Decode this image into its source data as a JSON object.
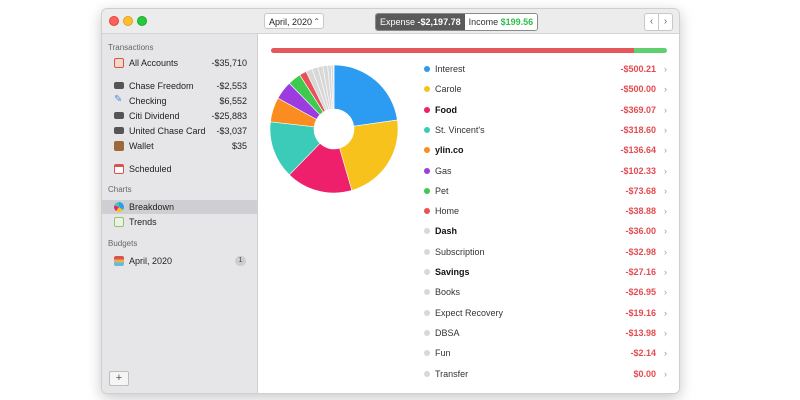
{
  "toolbar": {
    "month": "April, 2020",
    "expense_label": "Expense",
    "expense_amount": "-$2,197.78",
    "income_label": "Income",
    "income_amount": "$199.56",
    "prev_icon": "chevron-left-icon",
    "next_icon": "chevron-right-icon"
  },
  "sidebar": {
    "transactions_title": "Transactions",
    "accounts": [
      {
        "label": "All Accounts",
        "value": "-$35,710",
        "icon": "inbox-icon",
        "color": "#d9534f"
      },
      {
        "label": "Chase Freedom",
        "value": "-$2,553",
        "icon": "credit-card-icon",
        "color": "#555555"
      },
      {
        "label": "Checking",
        "value": "$6,552",
        "icon": "pencil-icon",
        "color": "#4a90d9"
      },
      {
        "label": "Citi Dividend",
        "value": "-$25,883",
        "icon": "credit-card-icon",
        "color": "#555555"
      },
      {
        "label": "United Chase Card",
        "value": "-$3,037",
        "icon": "credit-card-icon",
        "color": "#555555"
      },
      {
        "label": "Wallet",
        "value": "$35",
        "icon": "wallet-icon",
        "color": "#8b5a2b"
      }
    ],
    "scheduled": {
      "label": "Scheduled",
      "icon": "calendar-icon"
    },
    "charts_title": "Charts",
    "charts": [
      {
        "label": "Breakdown",
        "icon": "pie-chart-icon",
        "selected": true
      },
      {
        "label": "Trends",
        "icon": "line-chart-icon",
        "selected": false
      }
    ],
    "budgets_title": "Budgets",
    "budgets": [
      {
        "label": "April, 2020",
        "badge": "1",
        "icon": "budget-icon"
      }
    ],
    "add_label": "+"
  },
  "summary_bar": {
    "expense_fraction": 0.917,
    "income_fraction": 0.083,
    "expense_color": "#e5575a",
    "income_color": "#5fcf6f"
  },
  "chart_data": {
    "type": "pie",
    "donut": true,
    "series": [
      {
        "name": "Interest",
        "value": 500.21,
        "color": "#2b9cf2",
        "bold": false
      },
      {
        "name": "Carole",
        "value": 500.0,
        "color": "#f6c21b",
        "bold": false
      },
      {
        "name": "Food",
        "value": 369.07,
        "color": "#ee1f6b",
        "bold": true
      },
      {
        "name": "St. Vincent's",
        "value": 318.6,
        "color": "#3ccbb8",
        "bold": false
      },
      {
        "name": "ylin.co",
        "value": 136.64,
        "color": "#fb8c1f",
        "bold": true
      },
      {
        "name": "Gas",
        "value": 102.33,
        "color": "#9b3be0",
        "bold": false
      },
      {
        "name": "Pet",
        "value": 73.68,
        "color": "#3dca4e",
        "bold": false
      },
      {
        "name": "Home",
        "value": 38.88,
        "color": "#e9505a",
        "bold": false
      },
      {
        "name": "Dash",
        "value": 36.0,
        "color": "#d8d8d8",
        "bold": true
      },
      {
        "name": "Subscription",
        "value": 32.98,
        "color": "#d8d8d8",
        "bold": false
      },
      {
        "name": "Savings",
        "value": 27.16,
        "color": "#d8d8d8",
        "bold": true
      },
      {
        "name": "Books",
        "value": 26.95,
        "color": "#d8d8d8",
        "bold": false
      },
      {
        "name": "Expect Recovery",
        "value": 19.16,
        "color": "#d8d8d8",
        "bold": false
      },
      {
        "name": "DBSA",
        "value": 13.98,
        "color": "#d8d8d8",
        "bold": false
      },
      {
        "name": "Fun",
        "value": 2.14,
        "color": "#d8d8d8",
        "bold": false
      },
      {
        "name": "Transfer",
        "value": 0.0,
        "color": "#d8d8d8",
        "bold": false
      }
    ],
    "amount_labels": [
      "-$500.21",
      "-$500.00",
      "-$369.07",
      "-$318.60",
      "-$136.64",
      "-$102.33",
      "-$73.68",
      "-$38.88",
      "-$36.00",
      "-$32.98",
      "-$27.16",
      "-$26.95",
      "-$19.16",
      "-$13.98",
      "-$2.14",
      "$0.00"
    ]
  }
}
